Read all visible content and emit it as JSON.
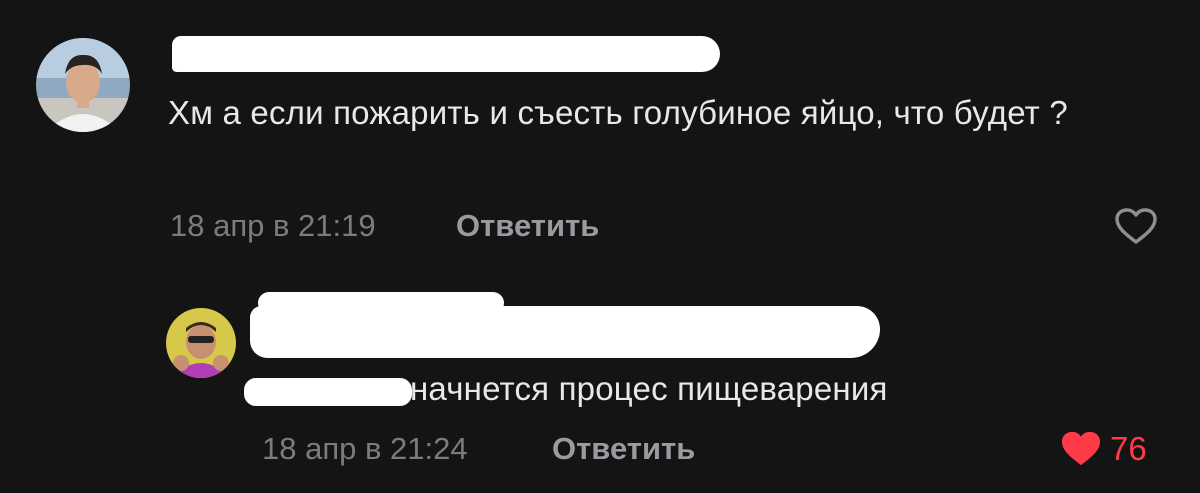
{
  "comment": {
    "text": "Хм а если пожарить и съесть голубиное яйцо, что будет ?",
    "timestamp": "18 апр в 21:19",
    "reply_label": "Ответить",
    "like_icon": "heart-outline-icon"
  },
  "reply": {
    "text": "начнется процес пищеварения",
    "timestamp": "18 апр в 21:24",
    "reply_label": "Ответить",
    "like_icon": "heart-filled-icon",
    "like_count": "76"
  },
  "colors": {
    "background": "#141414",
    "text": "#e8e8e8",
    "meta": "#7b7b80",
    "like_active": "#ff3b48"
  }
}
